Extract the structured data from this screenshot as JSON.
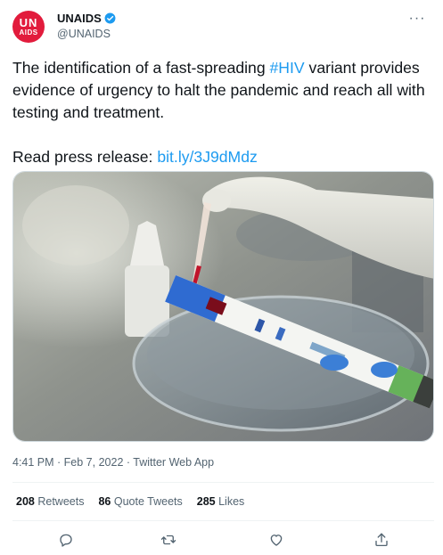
{
  "account": {
    "avatar_line1": "UN",
    "avatar_line2": "AIDS",
    "display_name": "UNAIDS",
    "handle": "@UNAIDS",
    "verified_icon": "verified-badge-icon",
    "more_icon": "more-horizontal-icon"
  },
  "tweet": {
    "text_part1": "The identification of a fast-spreading ",
    "hashtag": "#HIV",
    "text_part2": " variant provides evidence of urgency to halt the pandemic and reach all with testing and treatment.",
    "press_label": "Read press release: ",
    "link": "bit.ly/3J9dMdz"
  },
  "meta": {
    "time": "4:41 PM",
    "sep1": " · ",
    "date": "Feb 7, 2022",
    "sep2": " · ",
    "source": "Twitter Web App"
  },
  "stats": {
    "retweets_count": "208",
    "retweets_label": "Retweets",
    "quotes_count": "86",
    "quotes_label": "Quote Tweets",
    "likes_count": "285",
    "likes_label": "Likes"
  },
  "actions": [
    "reply-icon",
    "retweet-icon",
    "like-icon",
    "share-icon"
  ],
  "colors": {
    "brand_red": "#e21b3c",
    "link_blue": "#1d9bf0",
    "muted_gray": "#536471"
  }
}
